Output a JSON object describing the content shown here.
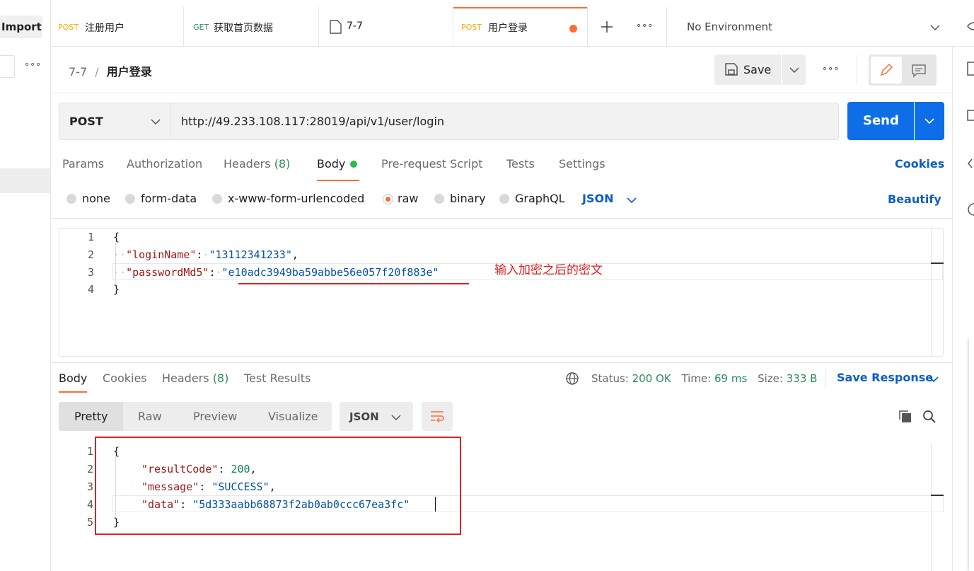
{
  "left_panel": {
    "import_label": "Import",
    "more": "∘∘∘"
  },
  "tabs": [
    {
      "method": "POST",
      "name": "注册用户"
    },
    {
      "method": "GET",
      "name": "获取首页数据"
    },
    {
      "method": "",
      "name": "7-7"
    },
    {
      "method": "POST",
      "name": "用户登录"
    }
  ],
  "tabbar": {
    "more": "∘∘∘",
    "environment": "No Environment"
  },
  "breadcrumb": {
    "parent": "7-7",
    "sep": "/",
    "current": "用户登录"
  },
  "toolbar": {
    "save_label": "Save",
    "more": "∘∘∘"
  },
  "request": {
    "method": "POST",
    "url": "http://49.233.108.117:28019/api/v1/user/login",
    "send_label": "Send"
  },
  "req_tabs": {
    "params": "Params",
    "authorization": "Authorization",
    "headers": "Headers",
    "headers_count": "(8)",
    "body": "Body",
    "prerequest": "Pre-request Script",
    "tests": "Tests",
    "settings": "Settings",
    "cookies": "Cookies"
  },
  "body_types": {
    "none": "none",
    "form_data": "form-data",
    "urlencoded": "x-www-form-urlencoded",
    "raw": "raw",
    "binary": "binary",
    "graphql": "GraphQL",
    "format": "JSON",
    "beautify": "Beautify"
  },
  "req_code": {
    "open": "{",
    "k1": "\"loginName\"",
    "v1": "\"13112341233\"",
    "k2": "\"passwordMd5\"",
    "v2": "\"e10adc3949ba59abbe56e057f20f883e\"",
    "close": "}"
  },
  "annotation": "输入加密之后的密文",
  "resp_tabs": {
    "body": "Body",
    "cookies": "Cookies",
    "headers": "Headers",
    "headers_count": "(8)",
    "test_results": "Test Results"
  },
  "resp_status": {
    "status_label": "Status:",
    "status": "200 OK",
    "time_label": "Time:",
    "time": "69 ms",
    "size_label": "Size:",
    "size": "333 B",
    "save_response": "Save Response"
  },
  "resp_views": {
    "pretty": "Pretty",
    "raw": "Raw",
    "preview": "Preview",
    "visualize": "Visualize",
    "format": "JSON"
  },
  "resp_code": {
    "open": "{",
    "k1": "\"resultCode\"",
    "v1": "200",
    "k2": "\"message\"",
    "v2": "\"SUCCESS\"",
    "k3": "\"data\"",
    "v3": "\"5d333aabb68873f2ab0ab0ccc67ea3fc\"",
    "close": "}"
  },
  "line_numbers_req": [
    "1",
    "2",
    "3",
    "4"
  ],
  "line_numbers_resp": [
    "1",
    "2",
    "3",
    "4",
    "5"
  ],
  "colors": {
    "accent": "#ff6c37",
    "send": "#0d6ee8",
    "link": "#0b5ec7",
    "success": "#2e8b57",
    "annotation": "#e0201f"
  }
}
